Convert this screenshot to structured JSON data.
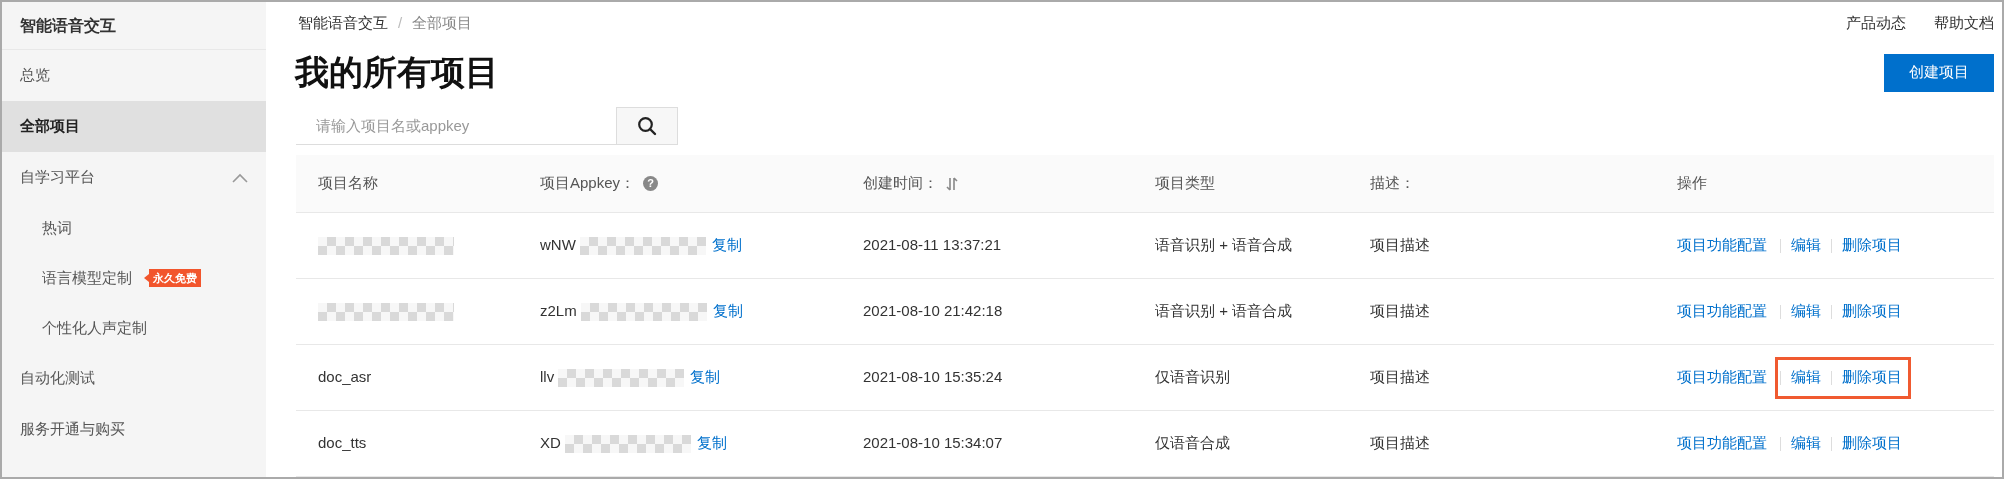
{
  "sidebar": {
    "title": "智能语音交互",
    "items": [
      {
        "label": "总览",
        "selected": false
      },
      {
        "label": "全部项目",
        "selected": true
      },
      {
        "label": "自学习平台",
        "selected": false,
        "expanded": true,
        "children": [
          {
            "label": "热词",
            "selected": false
          },
          {
            "label": "语言模型定制",
            "selected": false,
            "badge": "永久免费"
          },
          {
            "label": "个性化人声定制",
            "selected": false
          }
        ]
      },
      {
        "label": "自动化测试",
        "selected": false
      },
      {
        "label": "服务开通与购买",
        "selected": false
      }
    ]
  },
  "breadcrumb": [
    "智能语音交互",
    "全部项目"
  ],
  "breadcrumb_separator": "/",
  "top_links": [
    "产品动态",
    "帮助文档"
  ],
  "page_title": "我的所有项目",
  "create_button": "创建项目",
  "search": {
    "placeholder": "请输入项目名或appkey"
  },
  "table": {
    "help_icon": "?",
    "columns": [
      "项目名称",
      "项目Appkey：",
      "创建时间：",
      "项目类型",
      "描述：",
      "操作"
    ],
    "rows": [
      {
        "name_redacted": true,
        "appkey": "wNW",
        "copy": "复制",
        "created": "2021-08-11 13:37:21",
        "type": "语音识别 + 语音合成",
        "description": "项目描述",
        "actions": [
          "项目功能配置",
          "编辑",
          "删除项目"
        ],
        "highlighted": false
      },
      {
        "name_redacted": true,
        "appkey": "z2Lm",
        "copy": "复制",
        "created": "2021-08-10 21:42:18",
        "type": "语音识别 + 语音合成",
        "description": "项目描述",
        "actions": [
          "项目功能配置",
          "编辑",
          "删除项目"
        ],
        "highlighted": false
      },
      {
        "name": "doc_asr",
        "name_redacted": false,
        "appkey": "llv",
        "copy": "复制",
        "created": "2021-08-10 15:35:24",
        "type": "仅语音识别",
        "description": "项目描述",
        "actions": [
          "项目功能配置",
          "编辑",
          "删除项目"
        ],
        "highlighted": true
      },
      {
        "name": "doc_tts",
        "name_redacted": false,
        "appkey": "XD",
        "copy": "复制",
        "created": "2021-08-10 15:34:07",
        "type": "仅语音合成",
        "description": "项目描述",
        "actions": [
          "项目功能配置",
          "编辑",
          "删除项目"
        ],
        "highlighted": false
      }
    ]
  }
}
